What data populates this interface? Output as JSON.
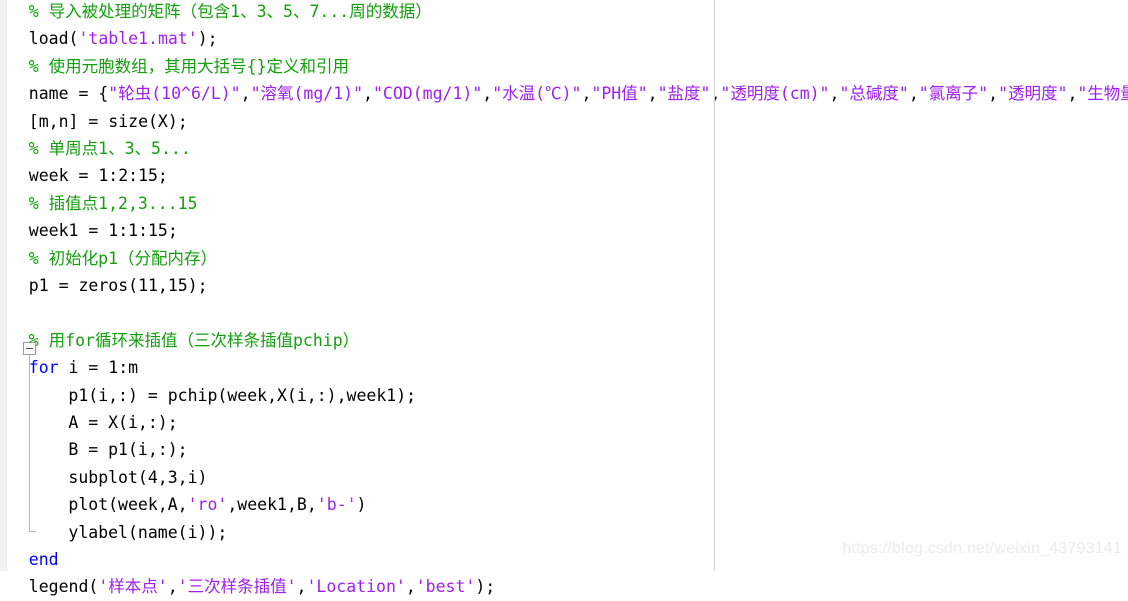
{
  "editor": {
    "language": "MATLAB",
    "colors": {
      "comment": "#12a00c",
      "string": "#a020f0",
      "keyword": "#0000ff",
      "plain": "#000000",
      "background": "#ffffff",
      "column_guide": "#d4d4d4",
      "fold_bracket": "#b4b4b4",
      "watermark": "#ebebeb"
    },
    "fold_widget": {
      "state": "expanded",
      "glyph": "minus-icon",
      "block_start_line": 13,
      "block_end_line": 19
    },
    "column_guide_column": 75,
    "lines": [
      {
        "n": 1,
        "indent": 2,
        "tokens": [
          {
            "t": "comment",
            "s": "% 导入被处理的矩阵（包含1、3、5、7...周的数据）"
          }
        ]
      },
      {
        "n": 2,
        "indent": 2,
        "tokens": [
          {
            "t": "plain",
            "s": "load("
          },
          {
            "t": "string",
            "s": "'table1.mat'"
          },
          {
            "t": "plain",
            "s": ");"
          }
        ]
      },
      {
        "n": 3,
        "indent": 2,
        "tokens": [
          {
            "t": "comment",
            "s": "% 使用元胞数组，其用大括号{}定义和引用"
          }
        ]
      },
      {
        "n": 4,
        "indent": 2,
        "tokens": [
          {
            "t": "plain",
            "s": "name = {"
          },
          {
            "t": "string",
            "s": "\"轮虫(10^6/L)\""
          },
          {
            "t": "plain",
            "s": ","
          },
          {
            "t": "string",
            "s": "\"溶氧(mg/1)\""
          },
          {
            "t": "plain",
            "s": ","
          },
          {
            "t": "string",
            "s": "\"COD(mg/1)\""
          },
          {
            "t": "plain",
            "s": ","
          },
          {
            "t": "string",
            "s": "\"水温(℃)\""
          },
          {
            "t": "plain",
            "s": ","
          },
          {
            "t": "string",
            "s": "\"PH值\""
          },
          {
            "t": "plain",
            "s": ","
          },
          {
            "t": "string",
            "s": "\"盐度\""
          },
          {
            "t": "plain",
            "s": ","
          },
          {
            "t": "string",
            "s": "\"透明度(cm)\""
          },
          {
            "t": "plain",
            "s": ","
          },
          {
            "t": "string",
            "s": "\"总碱度\""
          },
          {
            "t": "plain",
            "s": ","
          },
          {
            "t": "string",
            "s": "\"氯离子\""
          },
          {
            "t": "plain",
            "s": ","
          },
          {
            "t": "string",
            "s": "\"透明度\""
          },
          {
            "t": "plain",
            "s": ","
          },
          {
            "t": "string",
            "s": "\"生物量\""
          },
          {
            "t": "plain",
            "s": "};"
          }
        ]
      },
      {
        "n": 5,
        "indent": 2,
        "tokens": [
          {
            "t": "plain",
            "s": "[m,n] = size(X);"
          }
        ]
      },
      {
        "n": 6,
        "indent": 2,
        "tokens": [
          {
            "t": "comment",
            "s": "% 单周点1、3、5..."
          }
        ]
      },
      {
        "n": 7,
        "indent": 2,
        "tokens": [
          {
            "t": "plain",
            "s": "week = 1:2:15;"
          }
        ]
      },
      {
        "n": 8,
        "indent": 2,
        "tokens": [
          {
            "t": "comment",
            "s": "% 插值点1,2,3...15"
          }
        ]
      },
      {
        "n": 9,
        "indent": 2,
        "tokens": [
          {
            "t": "plain",
            "s": "week1 = 1:1:15;"
          }
        ]
      },
      {
        "n": 10,
        "indent": 2,
        "tokens": [
          {
            "t": "comment",
            "s": "% 初始化p1（分配内存）"
          }
        ]
      },
      {
        "n": 11,
        "indent": 2,
        "tokens": [
          {
            "t": "plain",
            "s": "p1 = zeros(11,15);"
          }
        ]
      },
      {
        "n": 12,
        "indent": 2,
        "tokens": []
      },
      {
        "n": 13,
        "indent": 2,
        "tokens": [
          {
            "t": "comment",
            "s": "% 用for循环来插值（三次样条插值pchip）"
          }
        ]
      },
      {
        "n": 14,
        "indent": 2,
        "tokens": [
          {
            "t": "keyword",
            "s": "for"
          },
          {
            "t": "plain",
            "s": " i = 1:m"
          }
        ]
      },
      {
        "n": 15,
        "indent": 6,
        "tokens": [
          {
            "t": "plain",
            "s": "p1(i,:) = pchip(week,X(i,:),week1);"
          }
        ]
      },
      {
        "n": 16,
        "indent": 6,
        "tokens": [
          {
            "t": "plain",
            "s": "A = X(i,:);"
          }
        ]
      },
      {
        "n": 17,
        "indent": 6,
        "tokens": [
          {
            "t": "plain",
            "s": "B = p1(i,:);"
          }
        ]
      },
      {
        "n": 18,
        "indent": 6,
        "tokens": [
          {
            "t": "plain",
            "s": "subplot(4,3,i)"
          }
        ]
      },
      {
        "n": 19,
        "indent": 6,
        "tokens": [
          {
            "t": "plain",
            "s": "plot(week,A,"
          },
          {
            "t": "string",
            "s": "'ro'"
          },
          {
            "t": "plain",
            "s": ",week1,B,"
          },
          {
            "t": "string",
            "s": "'b-'"
          },
          {
            "t": "plain",
            "s": ")"
          }
        ]
      },
      {
        "n": 20,
        "indent": 6,
        "tokens": [
          {
            "t": "plain",
            "s": "ylabel(name(i));"
          }
        ]
      },
      {
        "n": 21,
        "indent": 2,
        "tokens": [
          {
            "t": "keyword",
            "s": "end"
          }
        ]
      },
      {
        "n": 22,
        "indent": 2,
        "tokens": [
          {
            "t": "plain",
            "s": "legend("
          },
          {
            "t": "string",
            "s": "'样本点'"
          },
          {
            "t": "plain",
            "s": ","
          },
          {
            "t": "string",
            "s": "'三次样条插值'"
          },
          {
            "t": "plain",
            "s": ","
          },
          {
            "t": "string",
            "s": "'Location'"
          },
          {
            "t": "plain",
            "s": ","
          },
          {
            "t": "string",
            "s": "'best'"
          },
          {
            "t": "plain",
            "s": ");"
          }
        ]
      }
    ]
  },
  "watermark": {
    "text": "https://blog.csdn.net/weixin_43793141"
  }
}
